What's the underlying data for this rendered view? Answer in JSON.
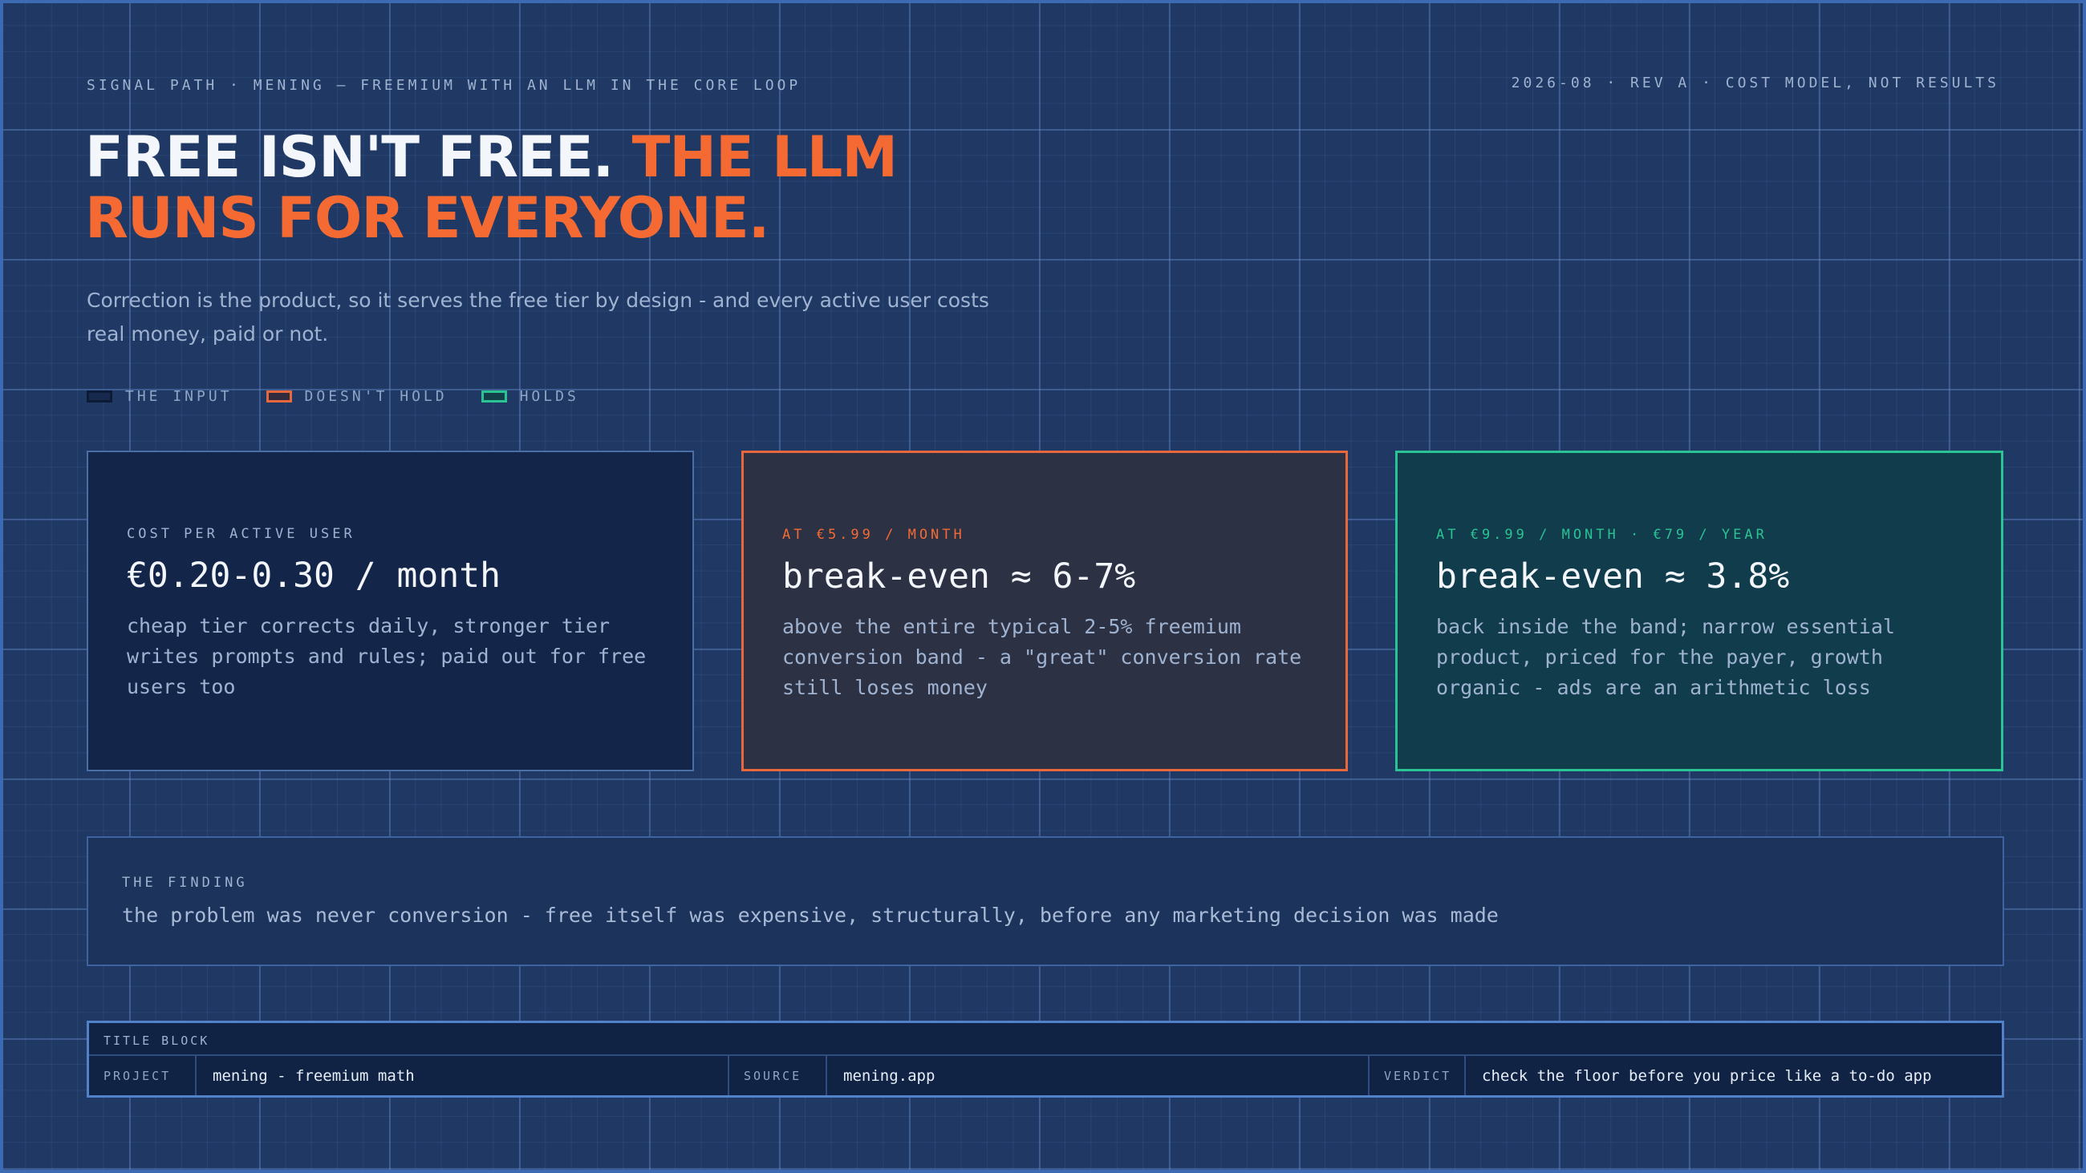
{
  "header": {
    "kicker": "SIGNAL PATH · MENING — FREEMIUM WITH AN LLM IN THE CORE LOOP",
    "revision": "2026-08 · REV A · COST MODEL, NOT RESULTS",
    "headline_main": "FREE ISN'T FREE. ",
    "headline_accent_1": "THE LLM",
    "headline_accent_2": "RUNS FOR EVERYONE.",
    "subtitle": "Correction is the product, so it serves the free tier by design - and every active user costs real money, paid or not."
  },
  "legend": [
    {
      "label": "THE INPUT",
      "color": "#17294c"
    },
    {
      "label": "DOESN'T HOLD",
      "color": "#e7683c"
    },
    {
      "label": "HOLDS",
      "color": "#2bc294"
    }
  ],
  "cards": [
    {
      "label": "COST PER ACTIVE USER",
      "value": "€0.20-0.30 / month",
      "description": "cheap tier corrects daily, stronger tier writes prompts and rules; paid out for free users too"
    },
    {
      "label": "AT €5.99 / MONTH",
      "value": "break-even ≈ 6-7%",
      "description": "above the entire typical 2-5% freemium conversion band - a \"great\" conversion rate still loses money"
    },
    {
      "label": "AT €9.99 / MONTH · €79 / YEAR",
      "value": "break-even ≈ 3.8%",
      "description": "back inside the band; narrow essential product, priced for the payer, growth organic - ads are an arithmetic loss"
    }
  ],
  "finding": {
    "label": "THE FINDING",
    "text": "the problem was never conversion - free itself was expensive, structurally, before any marketing decision was made"
  },
  "title_block": {
    "label": "TITLE BLOCK",
    "project_key": "PROJECT",
    "project_value": "mening - freemium math",
    "source_key": "SOURCE",
    "source_value": "mening.app",
    "verdict_key": "VERDICT",
    "verdict_value": "check the floor before you price like a to-do app"
  },
  "colors": {
    "background": "#1f3864",
    "accent": "#f56a33",
    "hold": "#2bc294",
    "fail": "#e7683c"
  }
}
